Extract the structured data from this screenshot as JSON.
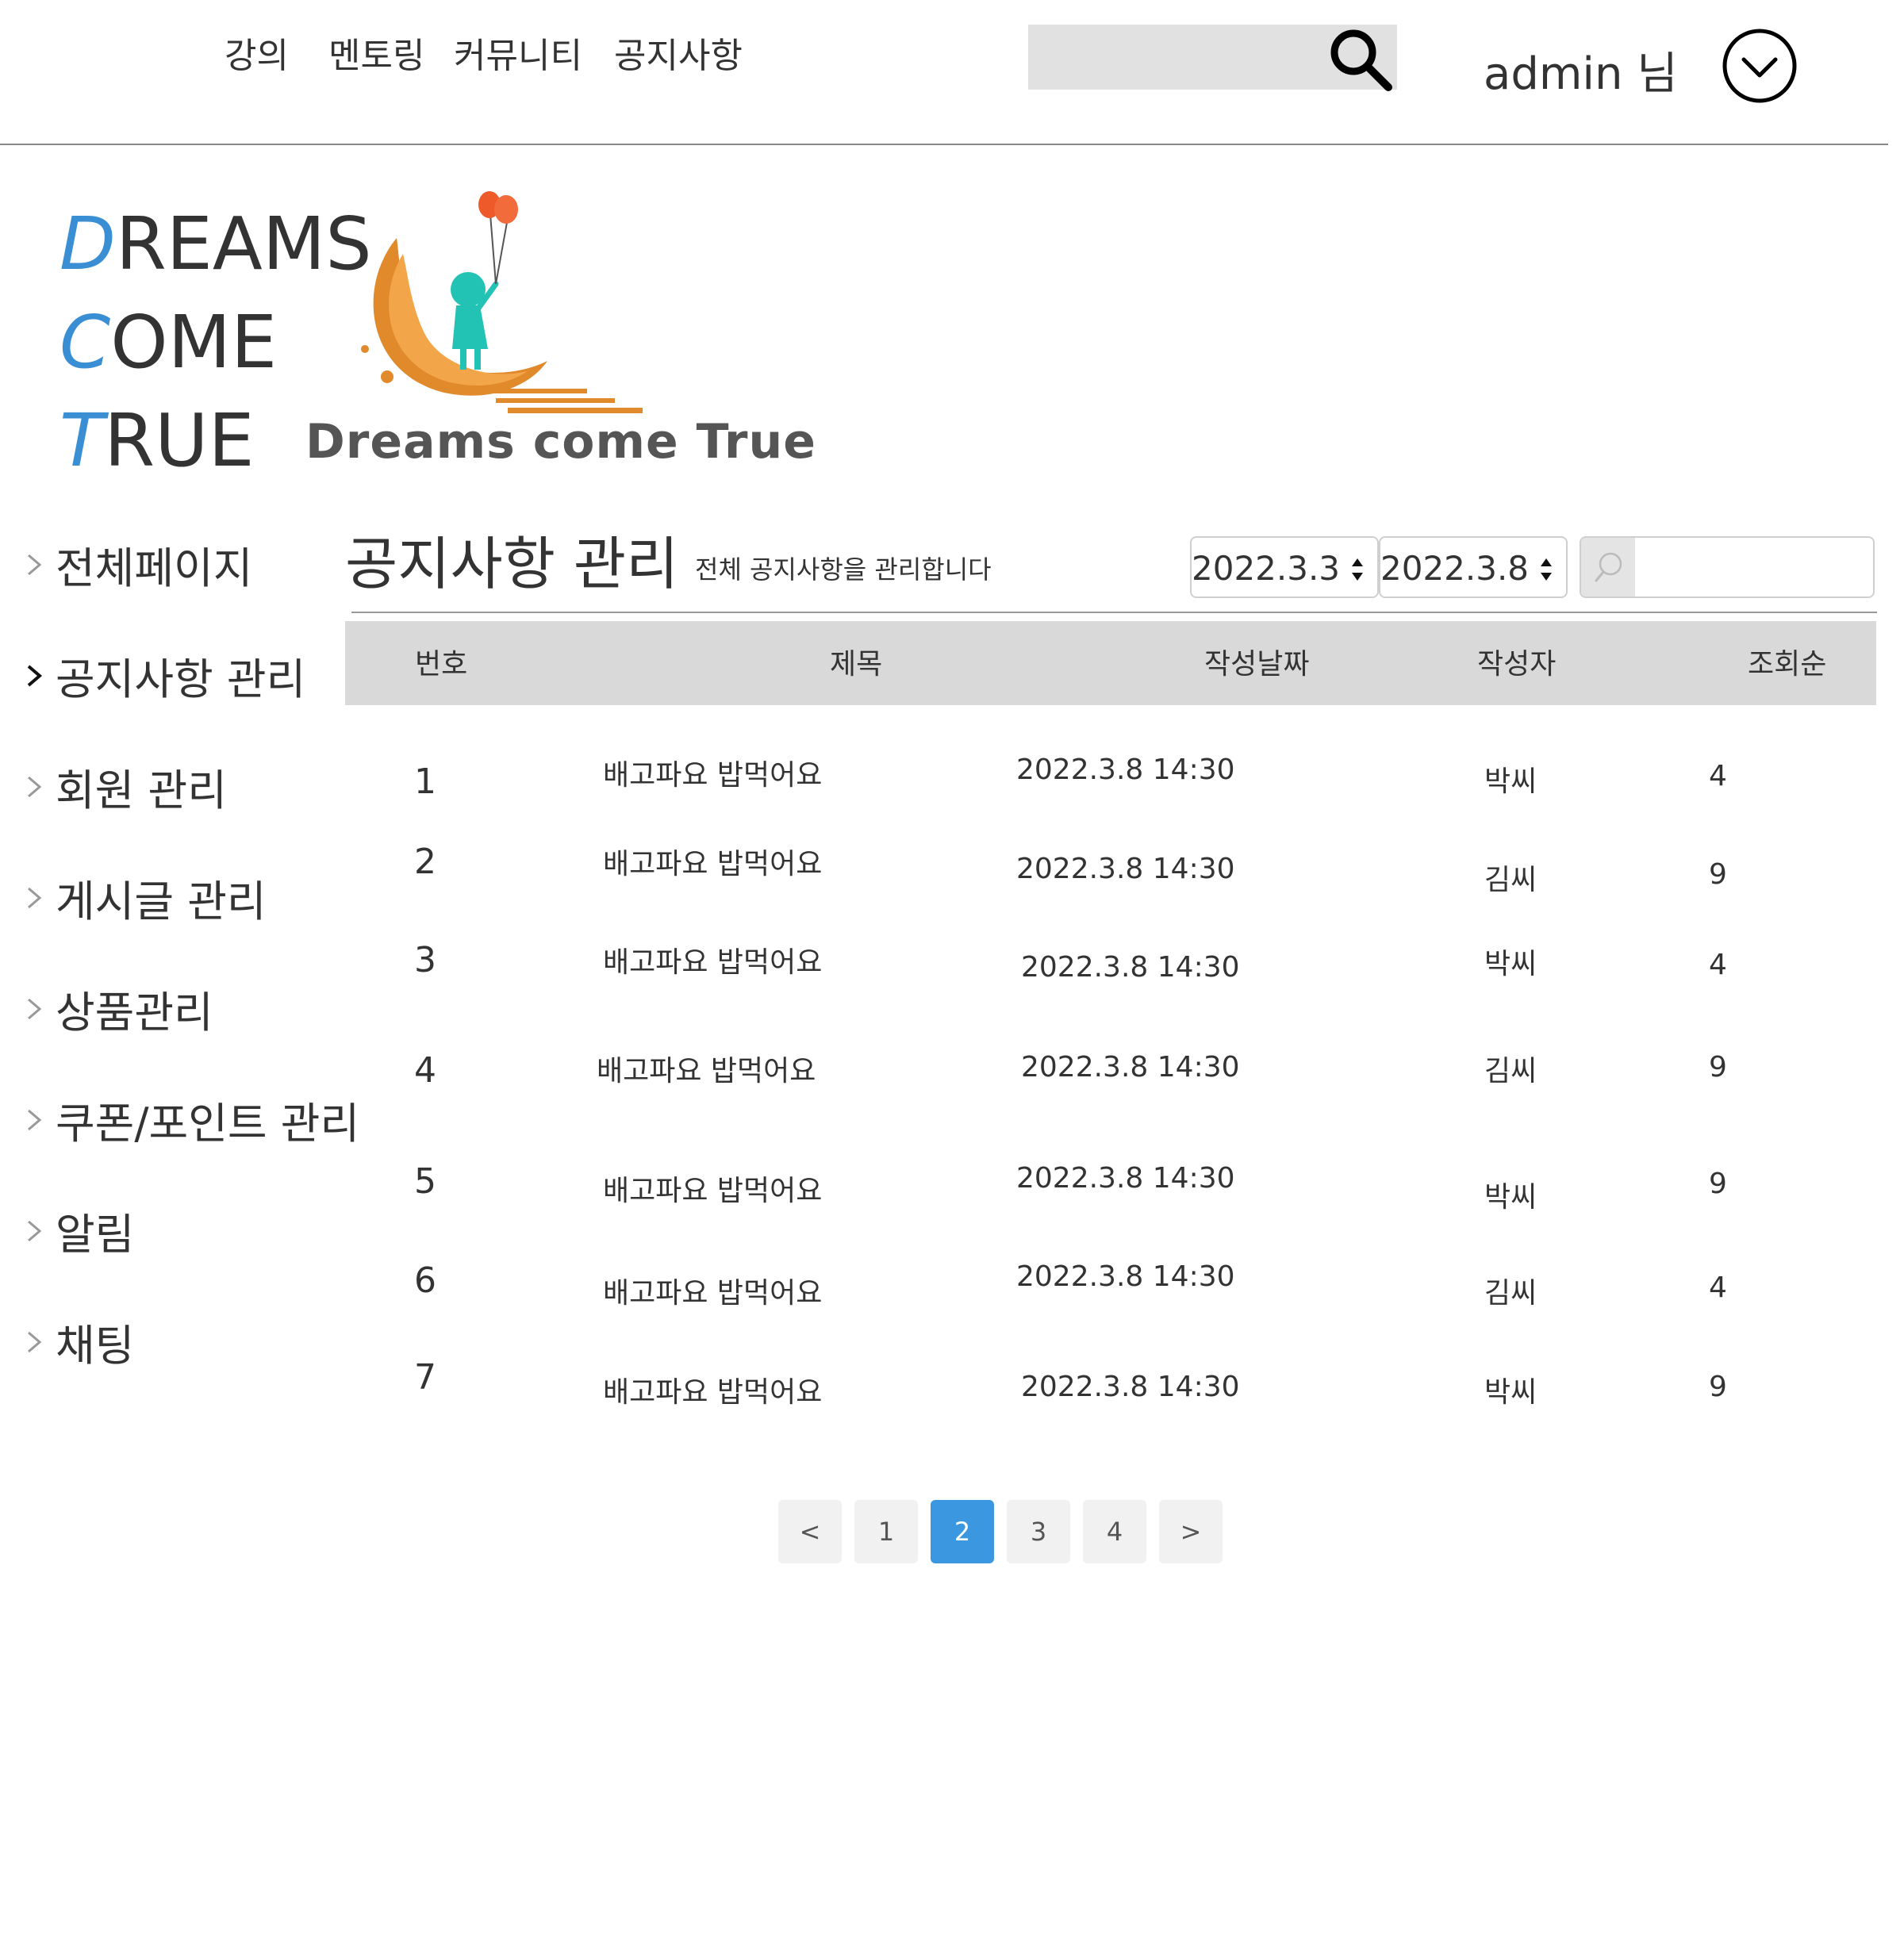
{
  "nav": {
    "items": [
      "강의",
      "멘토링",
      "커뮤니티",
      "공지사항"
    ]
  },
  "user": {
    "name": "admin 님"
  },
  "logo": {
    "lines": [
      {
        "first": "D",
        "rest": "REAMS"
      },
      {
        "first": "C",
        "rest": "OME"
      },
      {
        "first": "T",
        "rest": "RUE"
      }
    ],
    "caption": "Dreams come True",
    "accent_color": "#3a8ed4"
  },
  "sidebar": {
    "items": [
      {
        "label": "전체페이지",
        "active": false
      },
      {
        "label": "공지사항 관리",
        "active": true
      },
      {
        "label": "회원 관리",
        "active": false
      },
      {
        "label": "게시글 관리",
        "active": false
      },
      {
        "label": "상품관리",
        "active": false
      },
      {
        "label": "쿠폰/포인트 관리",
        "active": false
      },
      {
        "label": "알림",
        "active": false
      },
      {
        "label": "채팅",
        "active": false
      }
    ]
  },
  "page": {
    "title": "공지사항 관리",
    "subtitle": "전체 공지사항을 관리합니다"
  },
  "filters": {
    "start_date": "2022.3.3",
    "end_date": "2022.3.8",
    "search_value": ""
  },
  "table": {
    "headers": [
      "번호",
      "제목",
      "작성날짜",
      "작성자",
      "조회순"
    ],
    "rows": [
      {
        "no": "1",
        "title": "배고파요 밥먹어요",
        "date": "2022.3.8 14:30",
        "author": "박씨",
        "views": "4"
      },
      {
        "no": "2",
        "title": "배고파요 밥먹어요",
        "date": "2022.3.8 14:30",
        "author": "김씨",
        "views": "9"
      },
      {
        "no": "3",
        "title": "배고파요 밥먹어요",
        "date": "2022.3.8 14:30",
        "author": "박씨",
        "views": "4"
      },
      {
        "no": "4",
        "title": "배고파요 밥먹어요",
        "date": "2022.3.8 14:30",
        "author": "김씨",
        "views": "9"
      },
      {
        "no": "5",
        "title": "배고파요 밥먹어요",
        "date": "2022.3.8 14:30",
        "author": "박씨",
        "views": "9"
      },
      {
        "no": "6",
        "title": "배고파요 밥먹어요",
        "date": "2022.3.8 14:30",
        "author": "김씨",
        "views": "4"
      },
      {
        "no": "7",
        "title": "배고파요 밥먹어요",
        "date": "2022.3.8 14:30",
        "author": "박씨",
        "views": "9"
      }
    ]
  },
  "pagination": {
    "prev": "<",
    "pages": [
      "1",
      "2",
      "3",
      "4"
    ],
    "current": "2",
    "next": ">",
    "active_color": "#3b97df"
  }
}
